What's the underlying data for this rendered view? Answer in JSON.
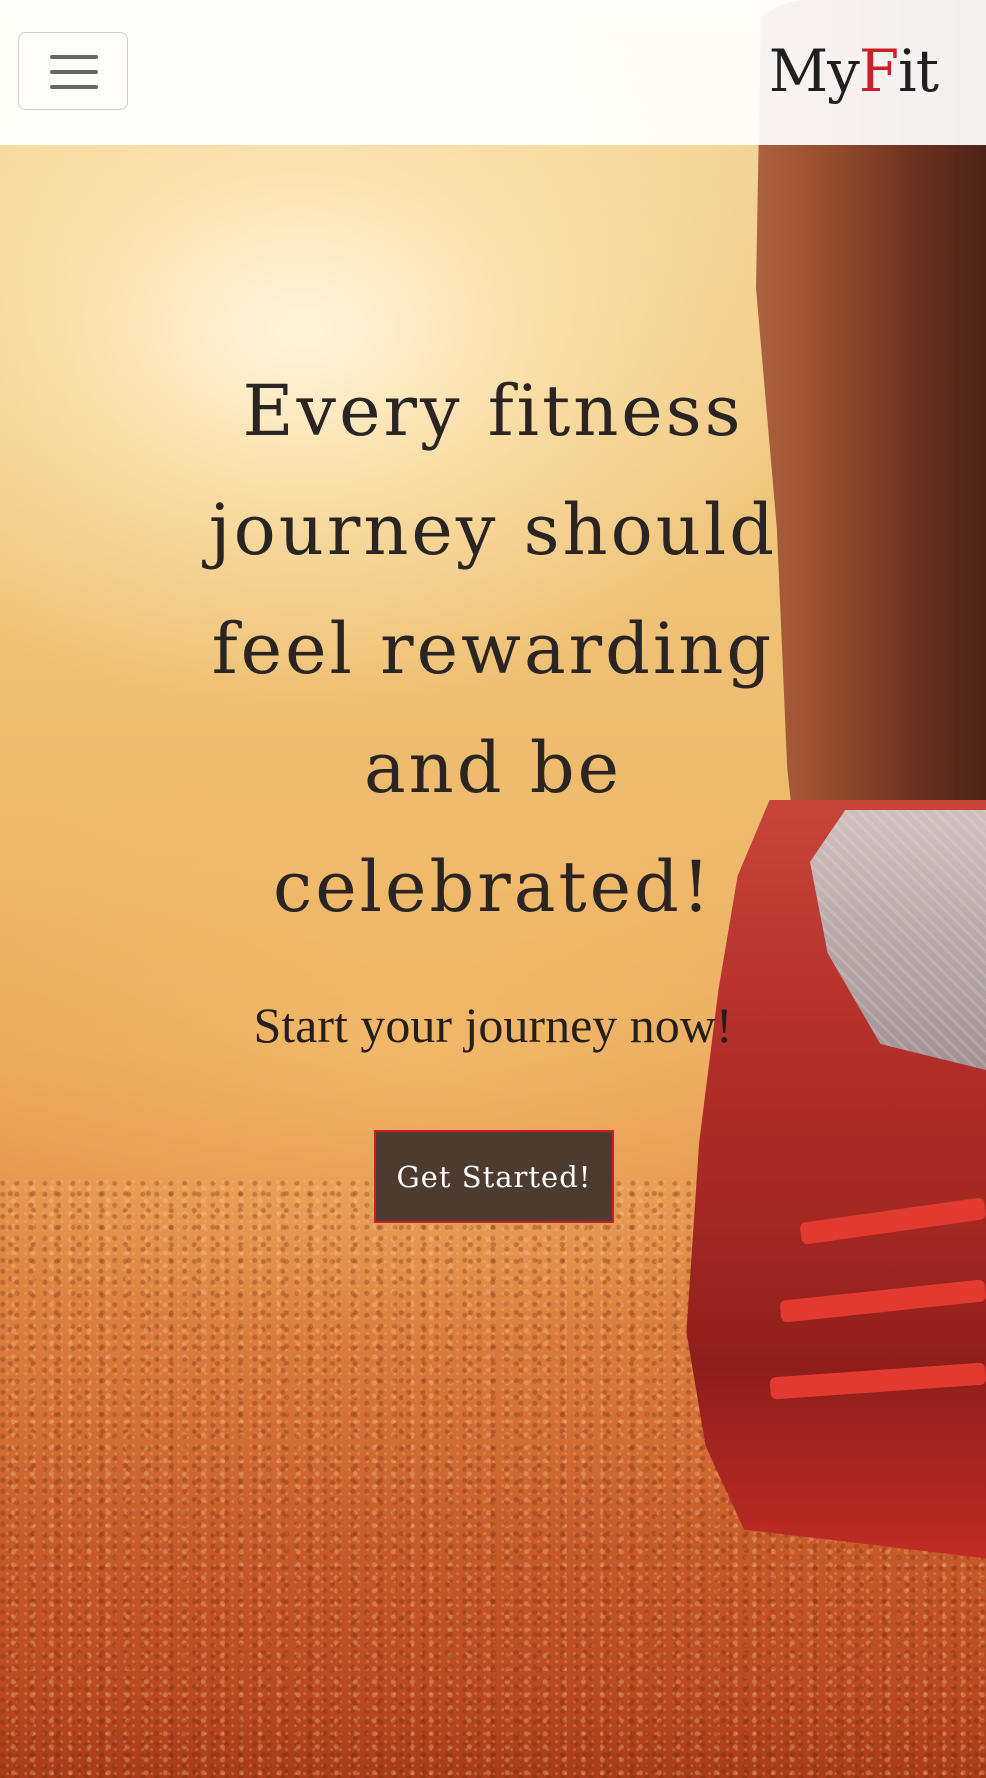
{
  "navbar": {
    "toggle_label": "Toggle navigation",
    "toggle_icon": "hamburger-menu-icon",
    "brand_prefix": "My",
    "brand_accent": "F",
    "brand_suffix": "it",
    "brand_accent_color": "#c9202a"
  },
  "hero": {
    "headline": "Every fitness journey should feel rewarding and be celebrated!",
    "subheadline": "Start your journey now!",
    "cta_label": "Get Started!",
    "cta_background": "#4e3b30",
    "cta_border": "#c8202a"
  }
}
